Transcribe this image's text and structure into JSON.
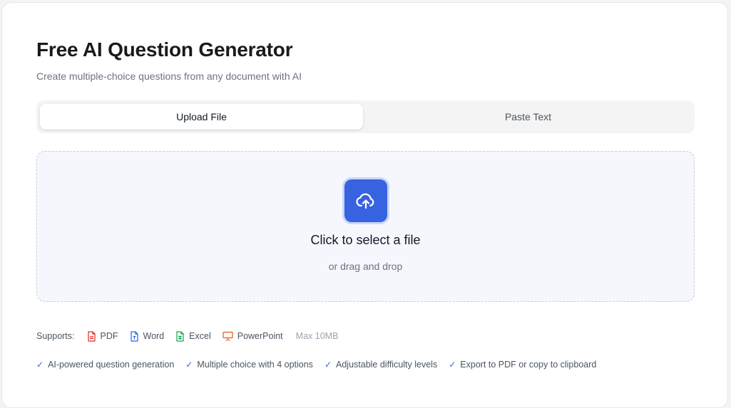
{
  "header": {
    "title": "Free AI Question Generator",
    "subtitle": "Create multiple-choice questions from any document with AI"
  },
  "tabs": [
    {
      "label": "Upload File",
      "active": true
    },
    {
      "label": "Paste Text",
      "active": false
    }
  ],
  "dropzone": {
    "icon": "cloud-upload-icon",
    "title": "Click to select a file",
    "subtitle": "or drag and drop"
  },
  "supports": {
    "label": "Supports:",
    "types": [
      {
        "label": "PDF",
        "icon": "pdf-file-icon",
        "color": "#dc2626"
      },
      {
        "label": "Word",
        "icon": "word-file-icon",
        "color": "#2563eb"
      },
      {
        "label": "Excel",
        "icon": "excel-file-icon",
        "color": "#16a34a"
      },
      {
        "label": "PowerPoint",
        "icon": "powerpoint-icon",
        "color": "#ea580c"
      }
    ],
    "max_size": "Max 10MB"
  },
  "features": [
    "AI-powered question generation",
    "Multiple choice with 4 options",
    "Adjustable difficulty levels",
    "Export to PDF or copy to clipboard"
  ],
  "colors": {
    "accent": "#3763e0",
    "dropzone_bg": "#f5f7fd"
  }
}
